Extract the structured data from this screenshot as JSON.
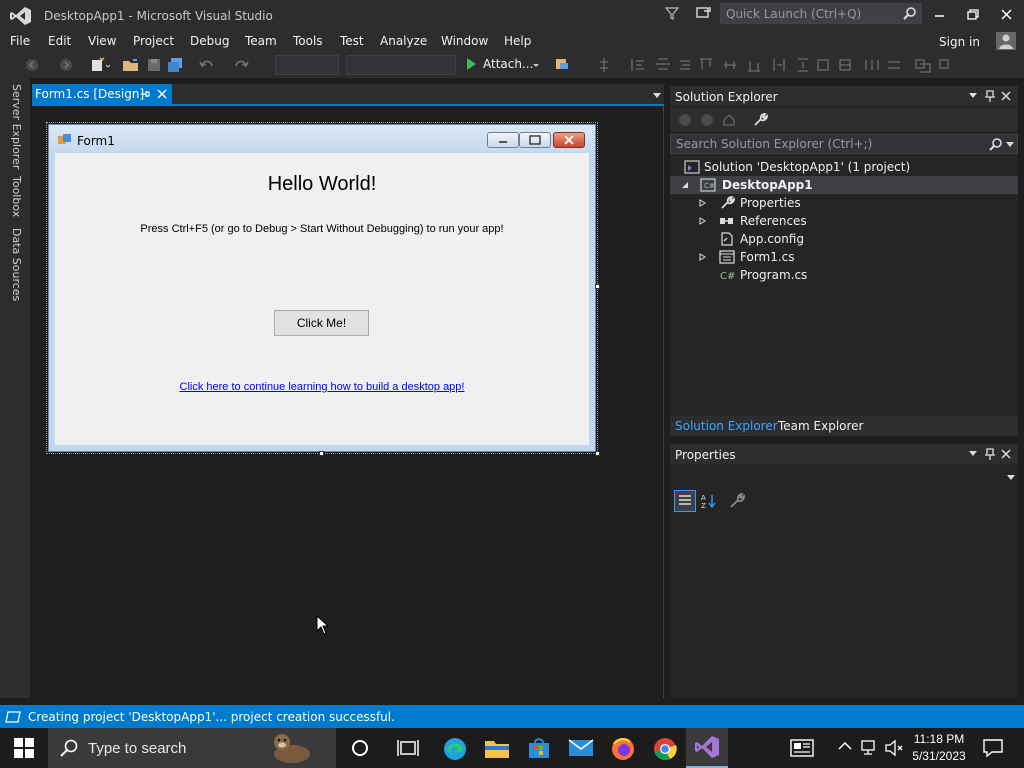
{
  "window": {
    "title": "DesktopApp1 - Microsoft Visual Studio"
  },
  "quick_launch": {
    "placeholder": "Quick Launch (Ctrl+Q)"
  },
  "menu": [
    "File",
    "Edit",
    "View",
    "Project",
    "Debug",
    "Team",
    "Tools",
    "Test",
    "Analyze",
    "Window",
    "Help"
  ],
  "account": {
    "signin_label": "Sign in"
  },
  "toolbar": {
    "attach_label": "Attach..."
  },
  "side_tabs": [
    "Server Explorer",
    "Toolbox",
    "Data Sources"
  ],
  "document_tab": {
    "label": "Form1.cs [Design]"
  },
  "form": {
    "title": "Form1",
    "hello": "Hello World!",
    "instructions": "Press Ctrl+F5 (or go to Debug > Start Without Debugging) to run your app!",
    "button_label": "Click Me!",
    "link_text": "Click here to continue learning how to build a desktop app!"
  },
  "solution_explorer": {
    "title": "Solution Explorer",
    "search_placeholder": "Search Solution Explorer (Ctrl+;)",
    "tree": [
      {
        "label": "Solution 'DesktopApp1' (1 project)",
        "icon": "solution-icon"
      },
      {
        "label": "DesktopApp1",
        "icon": "csharp-project-icon"
      },
      {
        "label": "Properties",
        "icon": "wrench-icon"
      },
      {
        "label": "References",
        "icon": "references-icon"
      },
      {
        "label": "App.config",
        "icon": "config-file-icon"
      },
      {
        "label": "Form1.cs",
        "icon": "form-file-icon"
      },
      {
        "label": "Program.cs",
        "icon": "csharp-file-icon"
      }
    ],
    "tabs": [
      "Solution Explorer",
      "Team Explorer"
    ]
  },
  "properties": {
    "title": "Properties"
  },
  "status": {
    "text": "Creating project 'DesktopApp1'... project creation successful."
  },
  "taskbar": {
    "search_placeholder": "Type to search",
    "time": "11:18 PM",
    "date": "5/31/2023"
  },
  "colors": {
    "accent": "#007acc",
    "chrome": "#2d2d30",
    "editor_bg": "#1e1e1e",
    "panel_bg": "#252526"
  }
}
